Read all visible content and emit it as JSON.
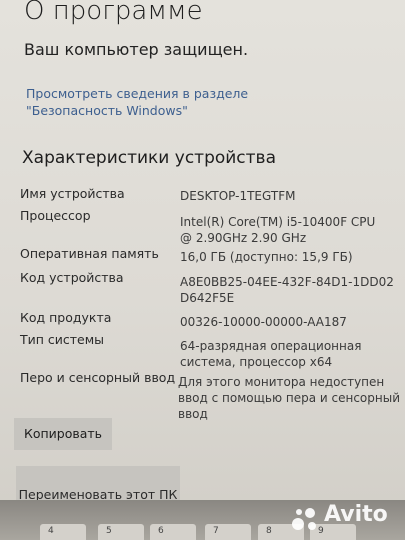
{
  "page": {
    "title": "О программе",
    "protection_status": "Ваш компьютер защищен.",
    "security_link": "Просмотреть сведения в разделе \"Безопасность Windows\""
  },
  "device_specs": {
    "section_title": "Характеристики устройства",
    "rows": [
      {
        "label": "Имя устройства",
        "value": "DESKTOP-1TEGTFM"
      },
      {
        "label": "Процессор",
        "value": "Intel(R) Core(TM) i5-10400F CPU @ 2.90GHz   2.90 GHz"
      },
      {
        "label": "Оперативная память",
        "value": "16,0 ГБ (доступно: 15,9 ГБ)"
      },
      {
        "label": "Код устройства",
        "value": "A8E0BB25-04EE-432F-84D1-1DD02D642F5E"
      },
      {
        "label": "Код продукта",
        "value": "00326-10000-00000-AA187"
      },
      {
        "label": "Тип системы",
        "value": "64-разрядная операционная система, процессор x64"
      },
      {
        "label": "Перо и сенсорный ввод",
        "value": "Для этого монитора недоступен ввод с помощью пера и сенсорный ввод"
      }
    ]
  },
  "buttons": {
    "copy_label": "Копировать",
    "rename_label": "Переименовать этот ПК"
  },
  "keyboard_keys": [
    "4",
    "5",
    "6",
    "7",
    "8",
    "9"
  ],
  "watermark": {
    "text": "Avito"
  },
  "colors": {
    "link": "#3d5f8f",
    "button": "#c6c4bf",
    "background": "#e4e2dc"
  }
}
